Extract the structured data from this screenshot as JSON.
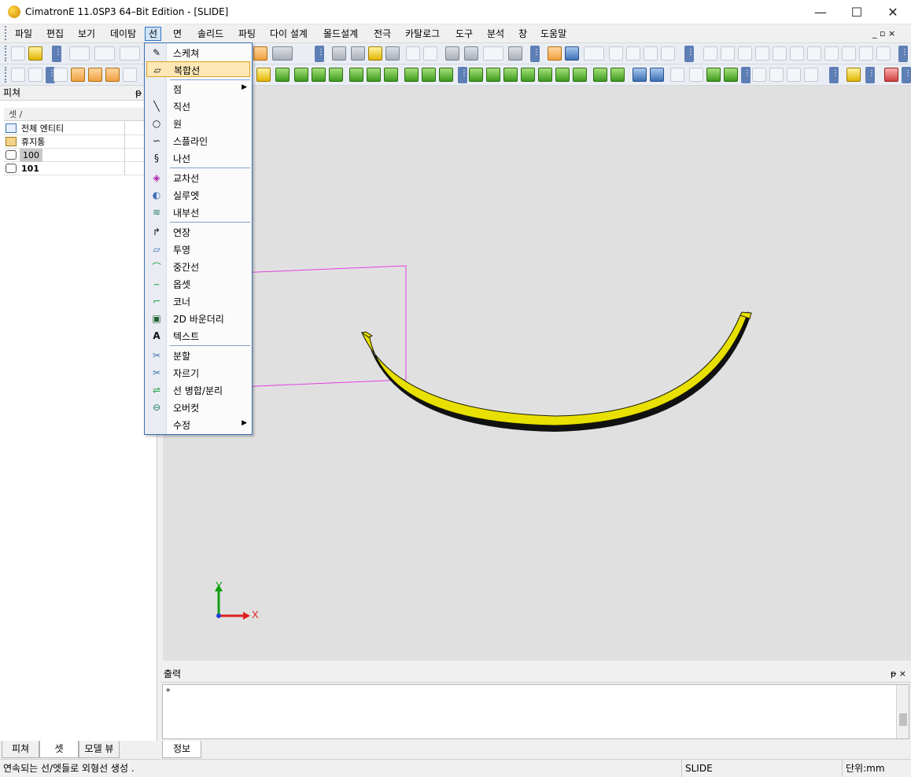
{
  "window": {
    "title": "CimatronE 11.0SP3 64–Bit Edition - [SLIDE]",
    "minimize": "—",
    "maximize": "☐",
    "close": "✕"
  },
  "menubar": {
    "items": [
      "파일",
      "편집",
      "보기",
      "데이탐",
      "선",
      "면",
      "솔리드",
      "파팅",
      "다이 설계",
      "몰드설계",
      "전극",
      "카탈로그",
      "도구",
      "분석",
      "창",
      "도움말"
    ],
    "mdi_controls": "_ ▫ ×"
  },
  "line_menu": {
    "items": [
      {
        "label": "스케쳐",
        "icon": "sketcher-icon"
      },
      {
        "label": "복합선",
        "icon": "composite-curve-icon",
        "highlighted": true
      },
      {
        "label": "점",
        "icon": "point-icon",
        "submenu": true
      },
      {
        "label": "직선",
        "icon": "line-icon"
      },
      {
        "label": "원",
        "icon": "circle-icon"
      },
      {
        "label": "스플라인",
        "icon": "spline-icon"
      },
      {
        "label": "나선",
        "icon": "helix-icon"
      },
      {
        "label": "교차선",
        "icon": "intersection-curve-icon"
      },
      {
        "label": "실루엣",
        "icon": "silhouette-icon"
      },
      {
        "label": "내부선",
        "icon": "internal-curve-icon"
      },
      {
        "label": "연장",
        "icon": "extend-icon"
      },
      {
        "label": "투영",
        "icon": "project-icon"
      },
      {
        "label": "중간선",
        "icon": "mid-curve-icon"
      },
      {
        "label": "옵셋",
        "icon": "offset-icon"
      },
      {
        "label": "코너",
        "icon": "corner-icon"
      },
      {
        "label": "2D 바운더리",
        "icon": "boundary-2d-icon"
      },
      {
        "label": "텍스트",
        "icon": "text-icon"
      },
      {
        "label": "분할",
        "icon": "divide-icon"
      },
      {
        "label": "자르기",
        "icon": "trim-icon"
      },
      {
        "label": "선 병합/분리",
        "icon": "merge-split-icon"
      },
      {
        "label": "오버컷",
        "icon": "overcut-icon"
      },
      {
        "label": "수정",
        "icon": "modify-icon",
        "submenu": true
      }
    ]
  },
  "left_panel": {
    "title": "피쳐",
    "pin": "ᵽ",
    "column_header": "셋 /",
    "rows": [
      {
        "name": "전체 엔티티",
        "icon": "all-entities-icon"
      },
      {
        "name": "휴지통",
        "icon": "trash-icon"
      },
      {
        "name": "100",
        "icon": "set-icon",
        "selected": true
      },
      {
        "name": "101",
        "icon": "set-icon",
        "bold": true
      }
    ]
  },
  "bottom_tabs": [
    "피쳐",
    "셋",
    "모델 뷰"
  ],
  "output": {
    "title": "출력",
    "content": "*",
    "tab": "정보",
    "pin": "ᵽ ×"
  },
  "status": {
    "message": "연속되는 선/엣들로 외형선 생성 .",
    "file": "SLIDE",
    "units": "단위:mm"
  },
  "axis": {
    "x_label": "X",
    "y_label": "Y"
  },
  "colors": {
    "accent": "#3c6fb4",
    "highlight": "#fde7b5",
    "part_yellow": "#e8e000",
    "sketch_magenta": "#e040e0"
  }
}
